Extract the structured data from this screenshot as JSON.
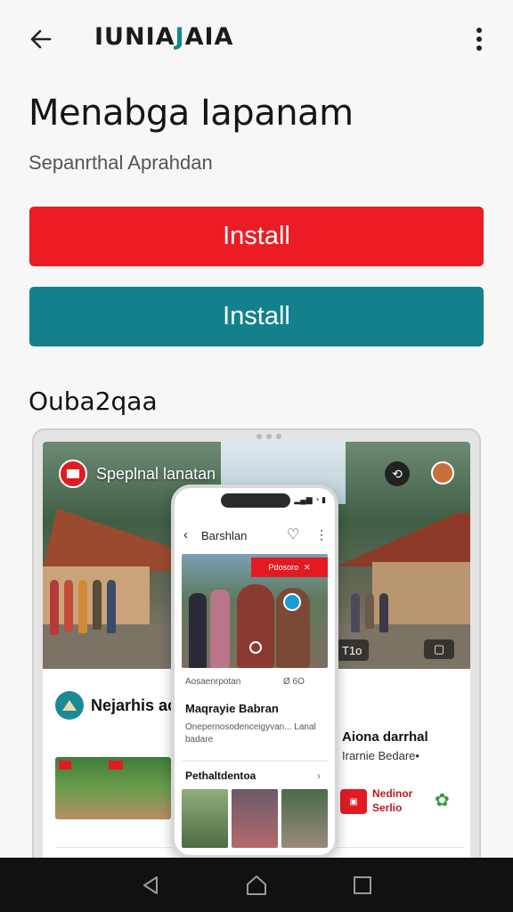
{
  "appbar": {
    "logo_part1": "IUNIA",
    "logo_part2": "J",
    "logo_part3": "AIA"
  },
  "app": {
    "title": "Menabga Iapanam",
    "subtitle": "Sepanrthal Aprahdan"
  },
  "buttons": {
    "install_primary": "Install",
    "install_secondary": "Install"
  },
  "screenshots": {
    "section_title": "Ouba2qaa",
    "tablet": {
      "hero_label": "Speplnal lanatan",
      "hero_pill": "T1o",
      "card_title": "Nejarhis ac",
      "right_title": "Aiona darrhal",
      "right_subtitle": "Irarnie Bedare•",
      "right_badge_title": "Nedinor",
      "right_badge_sub": "Serlio"
    },
    "phone": {
      "header_title": "Barshlan",
      "red_tag": "Pdosoro",
      "meta_left": "Aosaenrpotan",
      "meta_right": "Ø  6O",
      "headline": "Maqrayie Babran",
      "body": "Onepernosodenceigyvan... Lanal badare",
      "section": "Pethaltdentoa"
    }
  },
  "colors": {
    "install_primary": "#ec1c24",
    "install_secondary": "#13818c",
    "navbar": "#111111"
  },
  "icons": [
    "back-arrow-icon",
    "more-vert-icon",
    "nav-back-icon",
    "nav-home-icon",
    "nav-recents-icon"
  ]
}
